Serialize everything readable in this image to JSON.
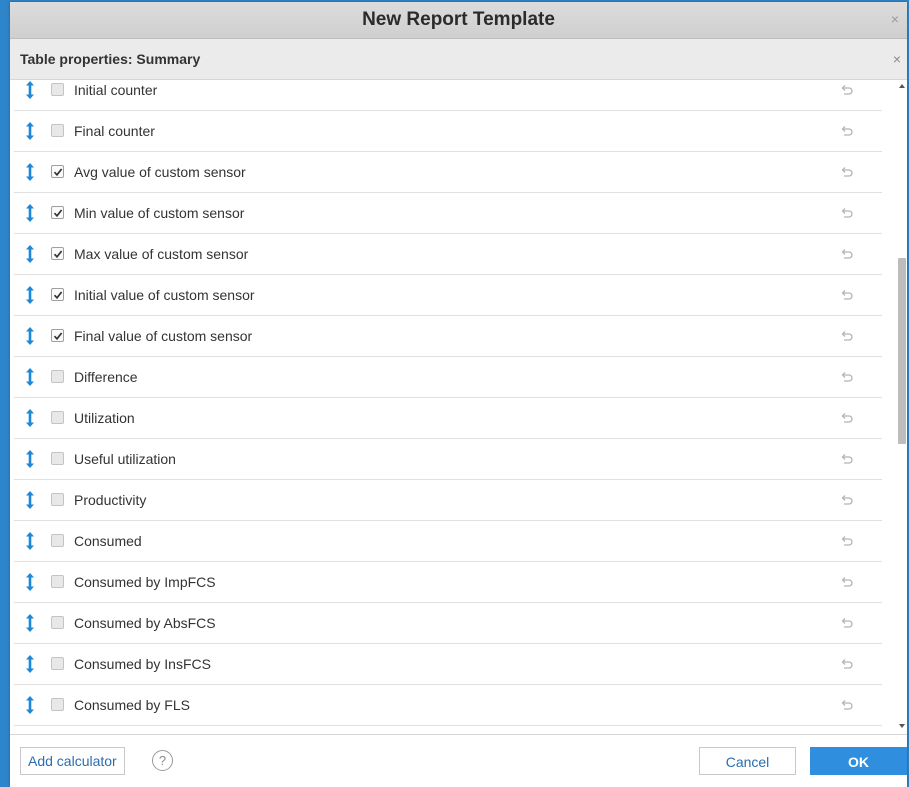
{
  "window": {
    "title": "New Report Template",
    "close_glyph": "×"
  },
  "dialog": {
    "title": "Table properties: Summary",
    "close_glyph": "×"
  },
  "rows": [
    {
      "label": "Initial counter",
      "checked": false
    },
    {
      "label": "Final counter",
      "checked": false
    },
    {
      "label": "Avg value of custom sensor",
      "checked": true
    },
    {
      "label": "Min value of custom sensor",
      "checked": true
    },
    {
      "label": "Max value of custom sensor",
      "checked": true
    },
    {
      "label": "Initial value of custom sensor",
      "checked": true
    },
    {
      "label": "Final value of custom sensor",
      "checked": true
    },
    {
      "label": "Difference",
      "checked": false
    },
    {
      "label": "Utilization",
      "checked": false
    },
    {
      "label": "Useful utilization",
      "checked": false
    },
    {
      "label": "Productivity",
      "checked": false
    },
    {
      "label": "Consumed",
      "checked": false
    },
    {
      "label": "Consumed by ImpFCS",
      "checked": false
    },
    {
      "label": "Consumed by AbsFCS",
      "checked": false
    },
    {
      "label": "Consumed by InsFCS",
      "checked": false
    },
    {
      "label": "Consumed by FLS",
      "checked": false
    }
  ],
  "footer": {
    "add_calculator_label": "Add calculator",
    "help_glyph": "?",
    "cancel_label": "Cancel",
    "ok_label": "OK"
  },
  "colors": {
    "accent": "#2f8fde",
    "drag_icon": "#1e88d8",
    "link_text": "#2a6db0",
    "background": "#2f85c9"
  },
  "icons": {
    "drag_handle": "drag-handle-icon",
    "checkbox": "checkbox-icon",
    "reset": "undo-icon",
    "help": "help-icon",
    "close": "close-icon"
  }
}
